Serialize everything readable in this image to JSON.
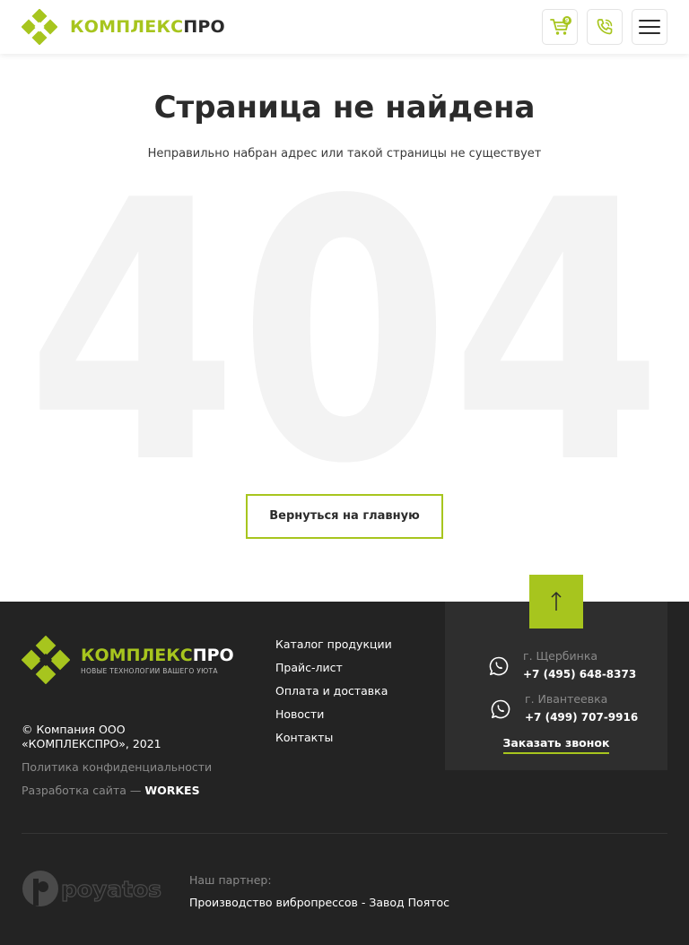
{
  "header": {
    "logo": {
      "part1": "КОМПЛЕКС",
      "part2": "ПРО"
    },
    "cart_count": "9",
    "icons": {
      "cart": "cart-icon",
      "phone": "phone-icon",
      "menu": "menu-icon"
    }
  },
  "main": {
    "title": "Страница не найдена",
    "subtitle": "Неправильно набран адрес или такой страницы не существует",
    "big_text": "404",
    "home_button": "Вернуться на главную"
  },
  "footer": {
    "logo": {
      "part1": "КОМПЛЕКС",
      "part2": "ПРО",
      "tagline": "НОВЫЕ ТЕХНОЛОГИИ ВАШЕГО УЮТА"
    },
    "copyright": "© Компания ООО «КОМПЛЕКСПРО», 2021",
    "privacy": "Политика конфиденциальности",
    "dev_prefix": "Разработка сайта — ",
    "dev_brand": "WORKES",
    "menu": [
      "Каталог продукции",
      "Прайс-лист",
      "Оплата и доставка",
      "Новости",
      "Контакты"
    ],
    "contacts": [
      {
        "city": "г. Щербинка",
        "phone": "+7 (495) 648-8373"
      },
      {
        "city": "г. Ивантеевка",
        "phone": "+7 (499) 707-9916"
      }
    ],
    "callback": "Заказать звонок",
    "partner_logo": "poyatos",
    "partner_label": "Наш партнер:",
    "partner_link": "Производство вибропрессов - Завод Поятос"
  },
  "colors": {
    "accent": "#a7c51e",
    "dark": "#232323",
    "text": "#2b2b2b",
    "ghost": "#f3f3f3"
  }
}
